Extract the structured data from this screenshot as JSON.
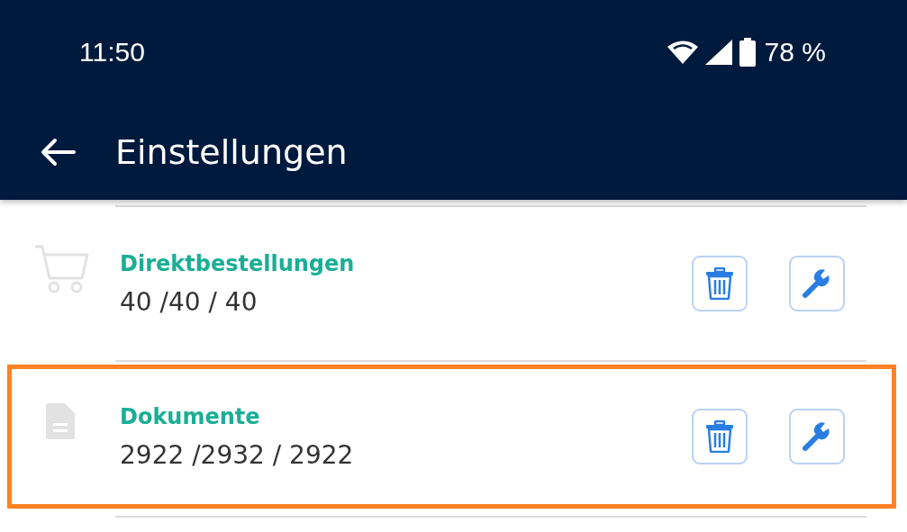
{
  "status_bar": {
    "time": "11:50",
    "battery": "78 %"
  },
  "app_bar": {
    "title": "Einstellungen"
  },
  "items": [
    {
      "kind": "cart",
      "title": "Direktbestellungen",
      "counts": "40 /40 / 40",
      "highlighted": false
    },
    {
      "kind": "document",
      "title": "Dokumente",
      "counts": "2922 /2932 / 2922",
      "highlighted": true
    }
  ]
}
